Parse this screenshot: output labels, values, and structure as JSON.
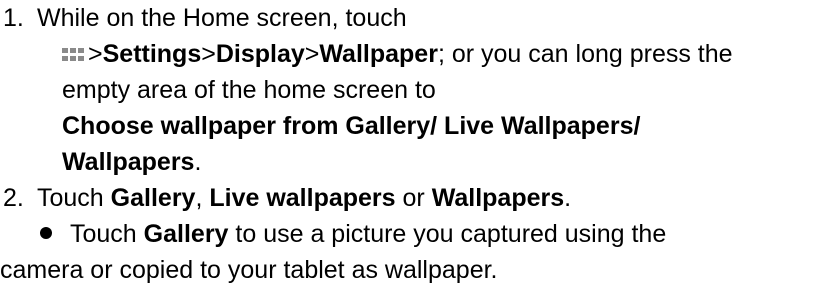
{
  "step1": {
    "number": "1.",
    "intro": "While on the Home screen, touch",
    "path": {
      "gt1": ">",
      "settings": "Settings",
      "gt2": ">",
      "display": "Display",
      "gt3": ">",
      "wallpaper": "Wallpaper",
      "rest": "; or you can long press the"
    },
    "line3": "empty area of the home screen to",
    "choose_line1": "Choose wallpaper from Gallery/ Live Wallpapers/",
    "choose_line2": "Wallpapers",
    "choose_end": "."
  },
  "step2": {
    "number": "2.",
    "touch": "Touch ",
    "gallery": "Gallery",
    "comma": ", ",
    "live": "Live wallpapers",
    "or": " or ",
    "wallpapers": "Wallpapers",
    "period": "."
  },
  "bullet": {
    "touch": "Touch ",
    "gallery": "Gallery",
    "rest1": " to use a picture you captured using the",
    "rest2": "camera or copied to your tablet as wallpaper."
  },
  "icons": {
    "apps": "apps-grid-icon",
    "bullet": "bullet-dot"
  },
  "colors": {
    "text": "#000000",
    "apps_icon": "#8a8a8a"
  }
}
